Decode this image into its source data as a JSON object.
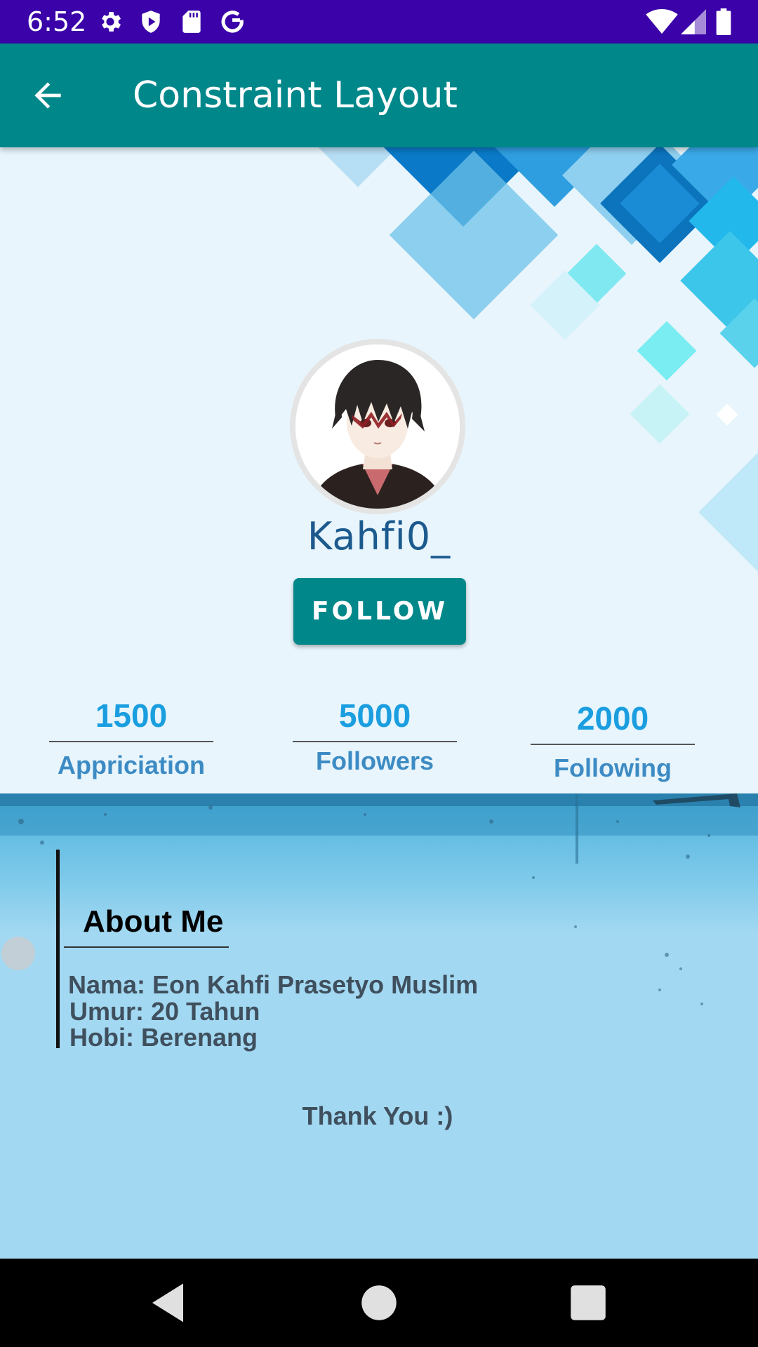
{
  "status_bar": {
    "time": "6:52",
    "left_icons": [
      "gear-icon",
      "shield-play-icon",
      "sd-card-icon",
      "google-icon"
    ],
    "right_icons": [
      "wifi-icon",
      "signal-icon",
      "battery-icon"
    ],
    "background": "#3a02a8"
  },
  "app_bar": {
    "title": "Constraint Layout",
    "back_icon": "arrow-back-icon",
    "background": "#00878a"
  },
  "profile": {
    "username": "Kahfi0_",
    "follow_button": "FOLLOW",
    "stats": [
      {
        "value": "1500",
        "label": "Appriciation"
      },
      {
        "value": "5000",
        "label": "Followers"
      },
      {
        "value": "2000",
        "label": "Following"
      }
    ],
    "accent_color": "#1a9ee0"
  },
  "about": {
    "title": "About Me",
    "lines": [
      "Nama: Eon Kahfi Prasetyo Muslim",
      "Umur: 20 Tahun",
      "Hobi: Berenang"
    ],
    "thanks": "Thank You :)"
  },
  "nav_bar": {
    "buttons": [
      "back-triangle-icon",
      "home-circle-icon",
      "recents-square-icon"
    ]
  }
}
